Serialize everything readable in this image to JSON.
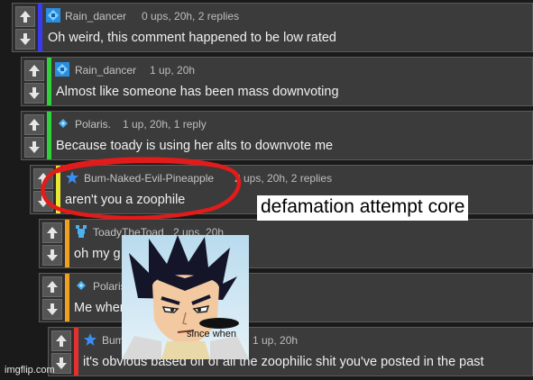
{
  "comments": [
    {
      "username": "Rain_dancer",
      "meta": "0 ups, 20h, 2 replies",
      "text": "Oh weird, this comment happened to be low rated",
      "bar_color": "#3a3af0",
      "icon": "pixel-diamond-icon"
    },
    {
      "username": "Rain_dancer",
      "meta": "1 up, 20h",
      "text": "Almost like someone has been mass downvoting",
      "bar_color": "#2fd23a",
      "icon": "pixel-diamond-icon"
    },
    {
      "username": "Polaris.",
      "meta": "1 up, 20h, 1 reply",
      "text": "Because toady is using her alts to downvote me",
      "bar_color": "#2fd23a",
      "icon": "small-diamond-icon"
    },
    {
      "username": "Bum-Naked-Evil-Pineapple",
      "meta": "2 ups, 20h, 2 replies",
      "text": "aren't you a zoophile",
      "bar_color": "#e8e832",
      "icon": "star-icon"
    },
    {
      "username": "ToadyTheToad",
      "meta": "2 ups, 20h",
      "text": "oh my g",
      "bar_color": "#f0a020",
      "icon": "toad-icon"
    },
    {
      "username": "Polaris",
      "meta": "",
      "text": "Me when",
      "bar_color": "#f0a020",
      "icon": "small-diamond-icon"
    },
    {
      "username": "Bum",
      "meta": "1 up, 20h",
      "text": "it's obvious based off of all the zoophilic shit you've posted in the past",
      "bar_color": "#e03030",
      "icon": "star-icon"
    }
  ],
  "caption": "defamation attempt core",
  "meme_text": "since when",
  "watermark": "imgflip.com",
  "colors": {
    "circle": "#e21b1b",
    "caption_bg": "#ffffff"
  }
}
